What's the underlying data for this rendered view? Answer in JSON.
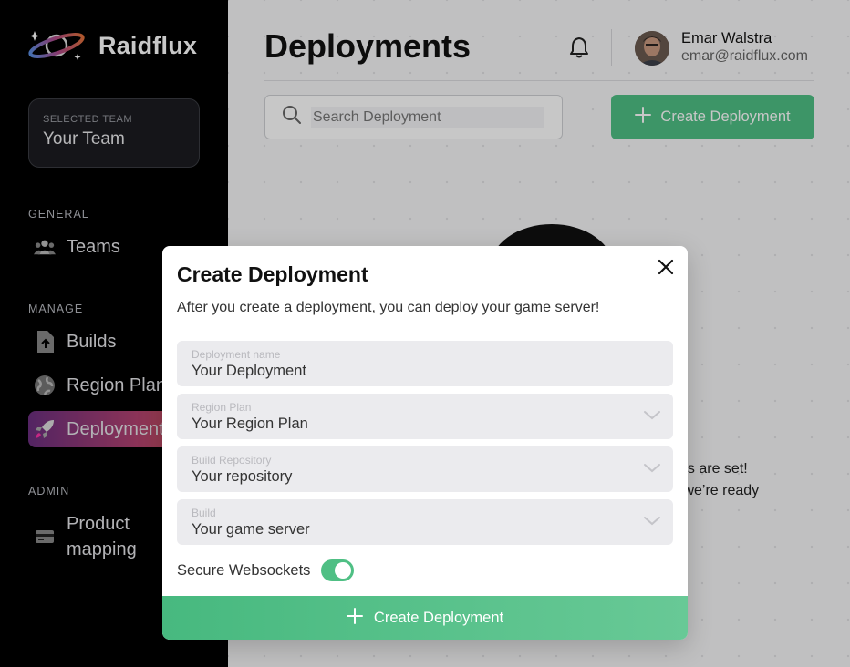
{
  "brand": {
    "name": "Raidflux"
  },
  "team": {
    "label": "SELECTED TEAM",
    "name": "Your Team"
  },
  "sidebar": {
    "sections": [
      {
        "title": "GENERAL",
        "items": [
          {
            "label": "Teams",
            "icon": "users-icon"
          }
        ]
      },
      {
        "title": "MANAGE",
        "items": [
          {
            "label": "Builds",
            "icon": "file-upload-icon"
          },
          {
            "label": "Region Plans",
            "icon": "globe-icon"
          },
          {
            "label": "Deployments",
            "icon": "rocket-icon",
            "active": true
          }
        ]
      },
      {
        "title": "ADMIN",
        "items": [
          {
            "label": "Product\nmapping",
            "label_line1": "Product",
            "label_line2": "mapping",
            "icon": "credit-card-icon"
          }
        ]
      }
    ]
  },
  "header": {
    "title": "Deployments",
    "user": {
      "name": "Emar Walstra",
      "email": "emar@raidflux.com"
    }
  },
  "toolbar": {
    "search_placeholder": "Search Deployment",
    "create_label": "Create Deployment"
  },
  "empty_state": {
    "line1": "ns are set!",
    "line2": " we’re ready"
  },
  "modal": {
    "title": "Create Deployment",
    "description": "After you create a deployment, you can deploy your game server!",
    "fields": [
      {
        "label": "Deployment name",
        "value": "Your Deployment"
      },
      {
        "label": "Region Plan",
        "value": "Your Region Plan"
      },
      {
        "label": "Build Repository",
        "value": "Your repository"
      },
      {
        "label": "Build",
        "value": "Your game server"
      }
    ],
    "toggle_label": "Secure Websockets",
    "toggle_on": true,
    "submit_label": "Create Deployment"
  },
  "colors": {
    "accent": "#4fbf84",
    "sidebar_bg": "#000000",
    "active_gradient_start": "#6b2f7f",
    "active_gradient_end": "#e0654a"
  }
}
